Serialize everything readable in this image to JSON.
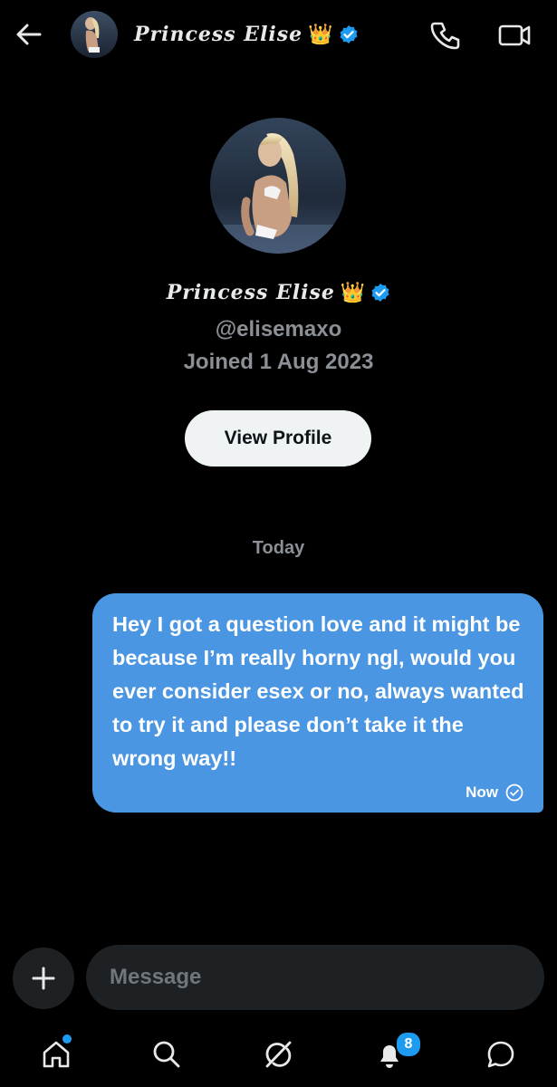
{
  "header": {
    "name": "Princess Elise",
    "emoji": "👑",
    "icons": [
      "back-arrow-icon",
      "verified-icon",
      "phone-icon",
      "video-camera-icon"
    ]
  },
  "profile": {
    "name": "Princess Elise",
    "emoji": "👑",
    "handle": "@elisemaxo",
    "joined": "Joined 1 Aug 2023",
    "view_profile_label": "View Profile"
  },
  "conversation": {
    "date_divider": "Today",
    "messages": [
      {
        "text": "Hey I got a question love and it might be because I’m really horny ngl, would you ever consider esex or no, always wanted to try it and please don’t take it the wrong way!!",
        "time": "Now",
        "outgoing": true
      }
    ]
  },
  "composer": {
    "placeholder": "Message",
    "add_icon": "plus-icon"
  },
  "navbar": {
    "items": [
      "home-icon",
      "search-icon",
      "grok-icon",
      "bell-icon",
      "messages-icon"
    ],
    "notifications_badge": "8"
  },
  "colors": {
    "background": "#000000",
    "bubble": "#4a96e3",
    "accent": "#1d9bf0",
    "muted": "#8b9096"
  }
}
